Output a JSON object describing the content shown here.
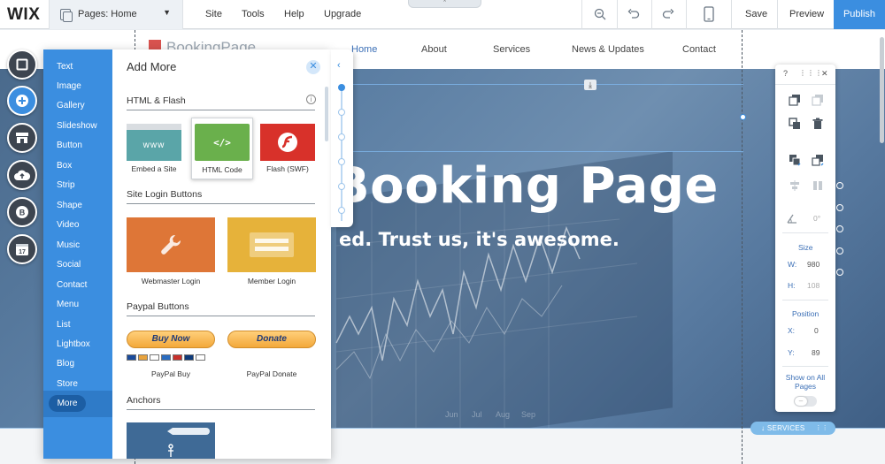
{
  "app": {
    "logo": "WIX",
    "pages_dropdown": "Pages: Home",
    "menu": [
      "Site",
      "Tools",
      "Help",
      "Upgrade"
    ],
    "actions": {
      "save": "Save",
      "preview": "Preview",
      "publish": "Publish"
    },
    "accent_color": "#3b8ee0"
  },
  "site": {
    "logo_text": "BookingPage",
    "nav": [
      "Home",
      "About",
      "Services",
      "News & Updates",
      "Contact"
    ],
    "active_nav": "Home",
    "hero_title": "Booking Page",
    "hero_subtitle": "ed. Trust us, it's awesome.",
    "months": [
      "Jun",
      "Jul",
      "Aug",
      "Sep"
    ],
    "anchor_label": "SERVICES"
  },
  "add_panel": {
    "title": "Add More",
    "categories": [
      "Text",
      "Image",
      "Gallery",
      "Slideshow",
      "Button",
      "Box",
      "Strip",
      "Shape",
      "Video",
      "Music",
      "Social",
      "Contact",
      "Menu",
      "List",
      "Lightbox",
      "Blog",
      "Store"
    ],
    "selected_category": "More",
    "sections": {
      "html_flash": {
        "title": "HTML & Flash",
        "items": [
          {
            "label": "Embed a Site",
            "thumb_text": "www"
          },
          {
            "label": "HTML Code",
            "thumb_text": "</>"
          },
          {
            "label": "Flash (SWF)"
          }
        ]
      },
      "site_login": {
        "title": "Site Login Buttons",
        "items": [
          {
            "label": "Webmaster Login"
          },
          {
            "label": "Member Login"
          }
        ]
      },
      "paypal": {
        "title": "Paypal Buttons",
        "items": [
          {
            "label": "PayPal Buy",
            "button_text": "Buy Now"
          },
          {
            "label": "PayPal Donate",
            "button_text": "Donate"
          }
        ]
      },
      "anchors": {
        "title": "Anchors"
      }
    }
  },
  "properties": {
    "header_help": "?",
    "size_title": "Size",
    "width_label": "W:",
    "width_value": "980",
    "height_label": "H:",
    "height_value": "108",
    "position_title": "Position",
    "x_label": "X:",
    "x_value": "0",
    "y_label": "Y:",
    "y_value": "89",
    "rotation_value": "0°",
    "show_on_all_pages": "Show on All Pages"
  }
}
